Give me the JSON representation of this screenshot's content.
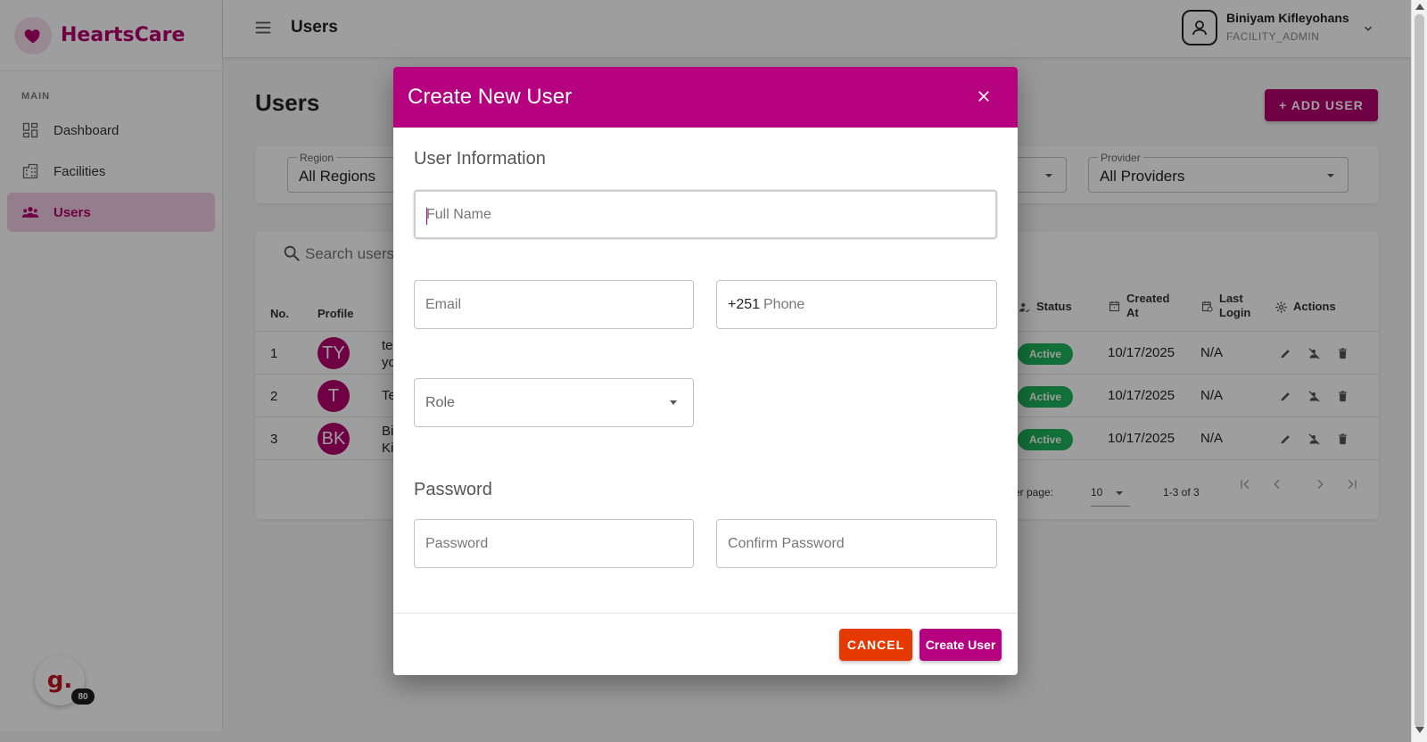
{
  "brand": {
    "name": "HeartsCare"
  },
  "sidebar": {
    "section": "MAIN",
    "items": [
      {
        "label": "Dashboard",
        "icon": "dashboard-icon"
      },
      {
        "label": "Facilities",
        "icon": "building-icon"
      },
      {
        "label": "Users",
        "icon": "people-icon",
        "active": true
      }
    ]
  },
  "topbar": {
    "title": "Users",
    "user_name": "Biniyam Kifleyohans",
    "user_role": "FACILITY_ADMIN"
  },
  "page": {
    "title": "Users",
    "add_button": "+ ADD USER"
  },
  "filters": {
    "region_label": "Region",
    "region_value": "All Regions",
    "provider_label": "Provider",
    "provider_value": "All Providers"
  },
  "table": {
    "search_placeholder": "Search users",
    "headers": {
      "no": "No.",
      "profile": "Profile",
      "status": "Status",
      "created_line1": "Created",
      "created_line2": "At",
      "last_line1": "Last",
      "last_line2": "Login",
      "actions": "Actions"
    },
    "rows": [
      {
        "no": "1",
        "initials": "TY",
        "name_line1": "te",
        "name_line2": "yo",
        "status": "Active",
        "created": "10/17/2025",
        "last_login": "N/A"
      },
      {
        "no": "2",
        "initials": "T",
        "name_line1": "Te",
        "name_line2": "",
        "status": "Active",
        "created": "10/17/2025",
        "last_login": "N/A"
      },
      {
        "no": "3",
        "initials": "BK",
        "name_line1": "Bi",
        "name_line2": "Ki",
        "status": "Active",
        "created": "10/17/2025",
        "last_login": "N/A"
      }
    ],
    "pagination": {
      "rows_label": "er page:",
      "rows_value": "10",
      "range": "1-3 of 3"
    }
  },
  "modal": {
    "title": "Create New User",
    "user_info_title": "User Information",
    "full_name_placeholder": "Full Name",
    "email_placeholder": "Email",
    "phone_prefix": "+251",
    "phone_placeholder": "Phone",
    "role_placeholder": "Role",
    "password_title": "Password",
    "password_placeholder": "Password",
    "confirm_password_placeholder": "Confirm Password",
    "cancel_label": "CANCEL",
    "create_label": "Create User"
  },
  "widget": {
    "letter": "g.",
    "count": "80"
  },
  "colors": {
    "brand": "#b5006f",
    "modal_header": "#b5007f",
    "cancel": "#e53900",
    "active_badge": "#1eb35a"
  }
}
